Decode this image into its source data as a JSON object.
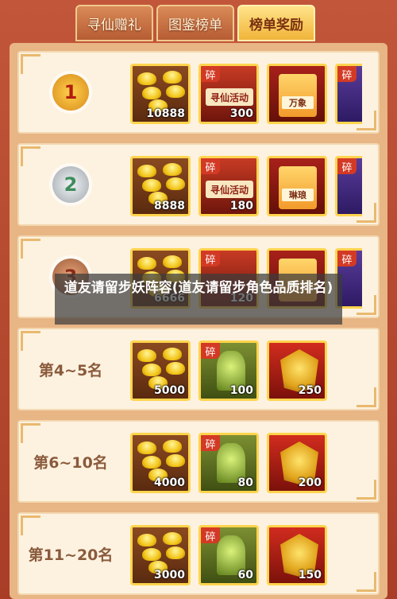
{
  "tabs": [
    {
      "label": "寻仙赠礼",
      "active": false
    },
    {
      "label": "图鉴榜单",
      "active": false
    },
    {
      "label": "榜单奖励",
      "active": true
    }
  ],
  "overlay_title": "道友请留步妖阵容(道友请留步角色品质排名)",
  "rows": [
    {
      "rank_medal": "1",
      "rank_label": "",
      "items": [
        {
          "kind": "gold-ingot",
          "icon": "gold-ingot-icon",
          "qty": "10888"
        },
        {
          "kind": "scroll",
          "icon": "scroll-icon",
          "tag": "碎",
          "label": "寻仙活动",
          "qty": "300"
        },
        {
          "kind": "card",
          "icon": "card-icon",
          "label": "万象",
          "qty": ""
        }
      ]
    },
    {
      "rank_medal": "2",
      "rank_label": "",
      "items": [
        {
          "kind": "gold-ingot",
          "icon": "gold-ingot-icon",
          "qty": "8888"
        },
        {
          "kind": "scroll",
          "icon": "scroll-icon",
          "tag": "碎",
          "label": "寻仙活动",
          "qty": "180"
        },
        {
          "kind": "card",
          "icon": "card-icon",
          "label": "琳琅",
          "qty": ""
        }
      ]
    },
    {
      "rank_medal": "3",
      "rank_label": "",
      "items": [
        {
          "kind": "gold-ingot",
          "icon": "gold-ingot-icon",
          "qty": "6666"
        },
        {
          "kind": "scroll",
          "icon": "scroll-icon",
          "tag": "碎",
          "label": "",
          "qty": "120"
        },
        {
          "kind": "card",
          "icon": "card-icon",
          "label": "",
          "qty": ""
        }
      ]
    },
    {
      "rank_medal": "",
      "rank_label": "第4~5名",
      "items": [
        {
          "kind": "gold-ingot",
          "icon": "gold-ingot-icon",
          "qty": "5000"
        },
        {
          "kind": "bell",
          "icon": "bell-icon",
          "tag": "碎",
          "qty": "100"
        },
        {
          "kind": "mask",
          "icon": "dragon-mask-icon",
          "qty": "250"
        }
      ]
    },
    {
      "rank_medal": "",
      "rank_label": "第6~10名",
      "items": [
        {
          "kind": "gold-ingot",
          "icon": "gold-ingot-icon",
          "qty": "4000"
        },
        {
          "kind": "bell",
          "icon": "bell-icon",
          "tag": "碎",
          "qty": "80"
        },
        {
          "kind": "mask",
          "icon": "dragon-mask-icon",
          "qty": "200"
        }
      ]
    },
    {
      "rank_medal": "",
      "rank_label": "第11~20名",
      "items": [
        {
          "kind": "gold-ingot",
          "icon": "gold-ingot-icon",
          "qty": "3000"
        },
        {
          "kind": "bell",
          "icon": "bell-icon",
          "tag": "碎",
          "qty": "60"
        },
        {
          "kind": "mask",
          "icon": "dragon-mask-icon",
          "qty": "150"
        }
      ]
    }
  ],
  "partial_item_tag": "碎",
  "colors": {
    "accent": "#ffd44d",
    "panel": "#fdf2e0",
    "frame": "#b8452e"
  }
}
